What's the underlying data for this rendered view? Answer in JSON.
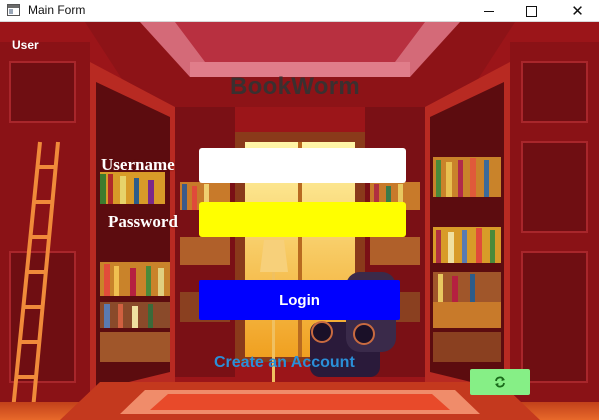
{
  "window": {
    "title": "Main Form",
    "app_icon": "form-icon",
    "controls": [
      "minimize-icon",
      "maximize-icon",
      "close-icon"
    ],
    "close_glyph": "✕"
  },
  "form": {
    "user_label": "User",
    "heading": "BookWorm",
    "username_label": "Username",
    "username_value": "",
    "password_label": "Password",
    "password_value": "",
    "login_label": "Login",
    "create_account_label": "Create an Account",
    "refresh_icon": "refresh-icon"
  },
  "colors": {
    "login_button": "#0000ff",
    "password_field": "#ffff00",
    "username_field": "#ffffff",
    "link": "#2a8fd8",
    "refresh_button": "#86ef86",
    "heading": "#3a3030",
    "background": "#a1191b"
  }
}
